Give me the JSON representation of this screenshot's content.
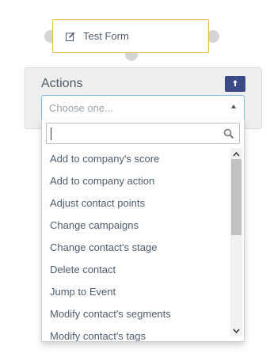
{
  "node": {
    "title": "Test Form",
    "icon": "edit-icon"
  },
  "panel": {
    "title": "Actions",
    "button_icon": "up-arrow-icon",
    "button_color": "#3a4a87"
  },
  "select": {
    "placeholder": "Choose one...",
    "search_value": "",
    "accent": "#7fbde0"
  },
  "options": [
    "Add to company's score",
    "Add to company action",
    "Adjust contact points",
    "Change campaigns",
    "Change contact's stage",
    "Delete contact",
    "Jump to Event",
    "Modify contact's segments",
    "Modify contact's tags"
  ],
  "colors": {
    "node_border": "#f0b952",
    "connector": "#d5d5d5"
  }
}
